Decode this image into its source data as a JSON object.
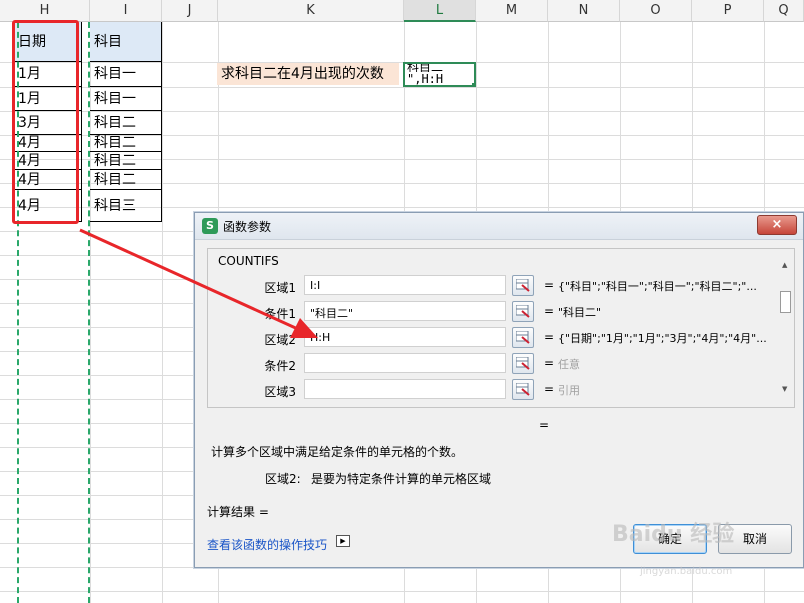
{
  "columns": [
    "H",
    "I",
    "J",
    "K",
    "L",
    "M",
    "N",
    "O",
    "P",
    "Q"
  ],
  "table": {
    "header": [
      "日期",
      "科目"
    ],
    "rows": [
      [
        "1月",
        "科目一"
      ],
      [
        "1月",
        "科目一"
      ],
      [
        "3月",
        "科目二"
      ],
      [
        "4月",
        "科目二"
      ],
      [
        "4月",
        "科目二"
      ],
      [
        "4月",
        "科目二"
      ],
      [
        "4月",
        "科目三"
      ]
    ]
  },
  "question": "求科目二在4月出现的次数",
  "active_cell": {
    "line1": "科目二",
    "line2": "\",H:H"
  },
  "dialog": {
    "title": "函数参数",
    "close": "×",
    "function_name": "COUNTIFS",
    "args": [
      {
        "label": "区域1",
        "value": "I:I",
        "result": "{\"科目\";\"科目一\";\"科目一\";\"科目二\";\"..."
      },
      {
        "label": "条件1",
        "value": "\"科目二\"",
        "result": "\"科目二\""
      },
      {
        "label": "区域2",
        "value": "H:H",
        "result": "{\"日期\";\"1月\";\"1月\";\"3月\";\"4月\";\"4月\"..."
      },
      {
        "label": "条件2",
        "value": "",
        "result": "任意"
      },
      {
        "label": "区域3",
        "value": "",
        "result": "引用"
      }
    ],
    "equals": "=",
    "description": "计算多个区域中满足给定条件的单元格的个数。",
    "arg_desc_label": "区域2:",
    "arg_desc_text": "是要为特定条件计算的单元格区域",
    "result_label": "计算结果 =",
    "help_link": "查看该函数的操作技巧",
    "ok": "确定",
    "cancel": "取消"
  },
  "watermark": "Baidu 经验",
  "watermark_url": "jingyan.baidu.com",
  "colors": {
    "selection_green": "#2e8b57",
    "annotation_red": "#e8262a",
    "header_fill": "#dde9f6",
    "question_fill": "#fbe5d6"
  }
}
